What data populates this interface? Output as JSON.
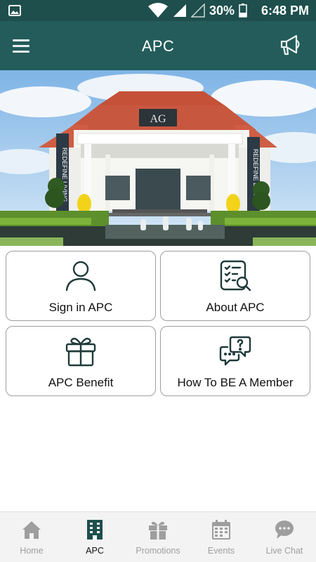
{
  "status_bar": {
    "battery": "30%",
    "time": "6:48 PM",
    "icons": [
      "image-icon",
      "wifi-icon",
      "signal-icon",
      "signal-empty-icon",
      "battery-icon"
    ]
  },
  "app_bar": {
    "title": "APC",
    "menu_icon": "hamburger-menu-icon",
    "action_icon": "megaphone-icon"
  },
  "hero": {
    "sign_text": "AG",
    "banner_left": "REDEFINE LIVING",
    "banner_right": "REDEFINE LIVING"
  },
  "tiles": [
    {
      "label": "Sign in APC",
      "icon": "user-icon"
    },
    {
      "label": "About APC",
      "icon": "checklist-search-icon"
    },
    {
      "label": "APC Benefit",
      "icon": "gift-icon"
    },
    {
      "label": "How To BE A Member",
      "icon": "chat-question-icon"
    }
  ],
  "bottom_nav": [
    {
      "label": "Home",
      "icon": "home-icon",
      "active": false
    },
    {
      "label": "APC",
      "icon": "building-icon",
      "active": true
    },
    {
      "label": "Promotions",
      "icon": "gift-icon",
      "active": false
    },
    {
      "label": "Events",
      "icon": "calendar-icon",
      "active": false
    },
    {
      "label": "Live Chat",
      "icon": "chat-bubble-icon",
      "active": false
    }
  ],
  "colors": {
    "primary": "#235c5a",
    "status_bar": "#1e4f4d",
    "icon_dark": "#1f3a3a",
    "nav_inactive": "#9e9e9e",
    "nav_active": "#1e4f4d"
  }
}
